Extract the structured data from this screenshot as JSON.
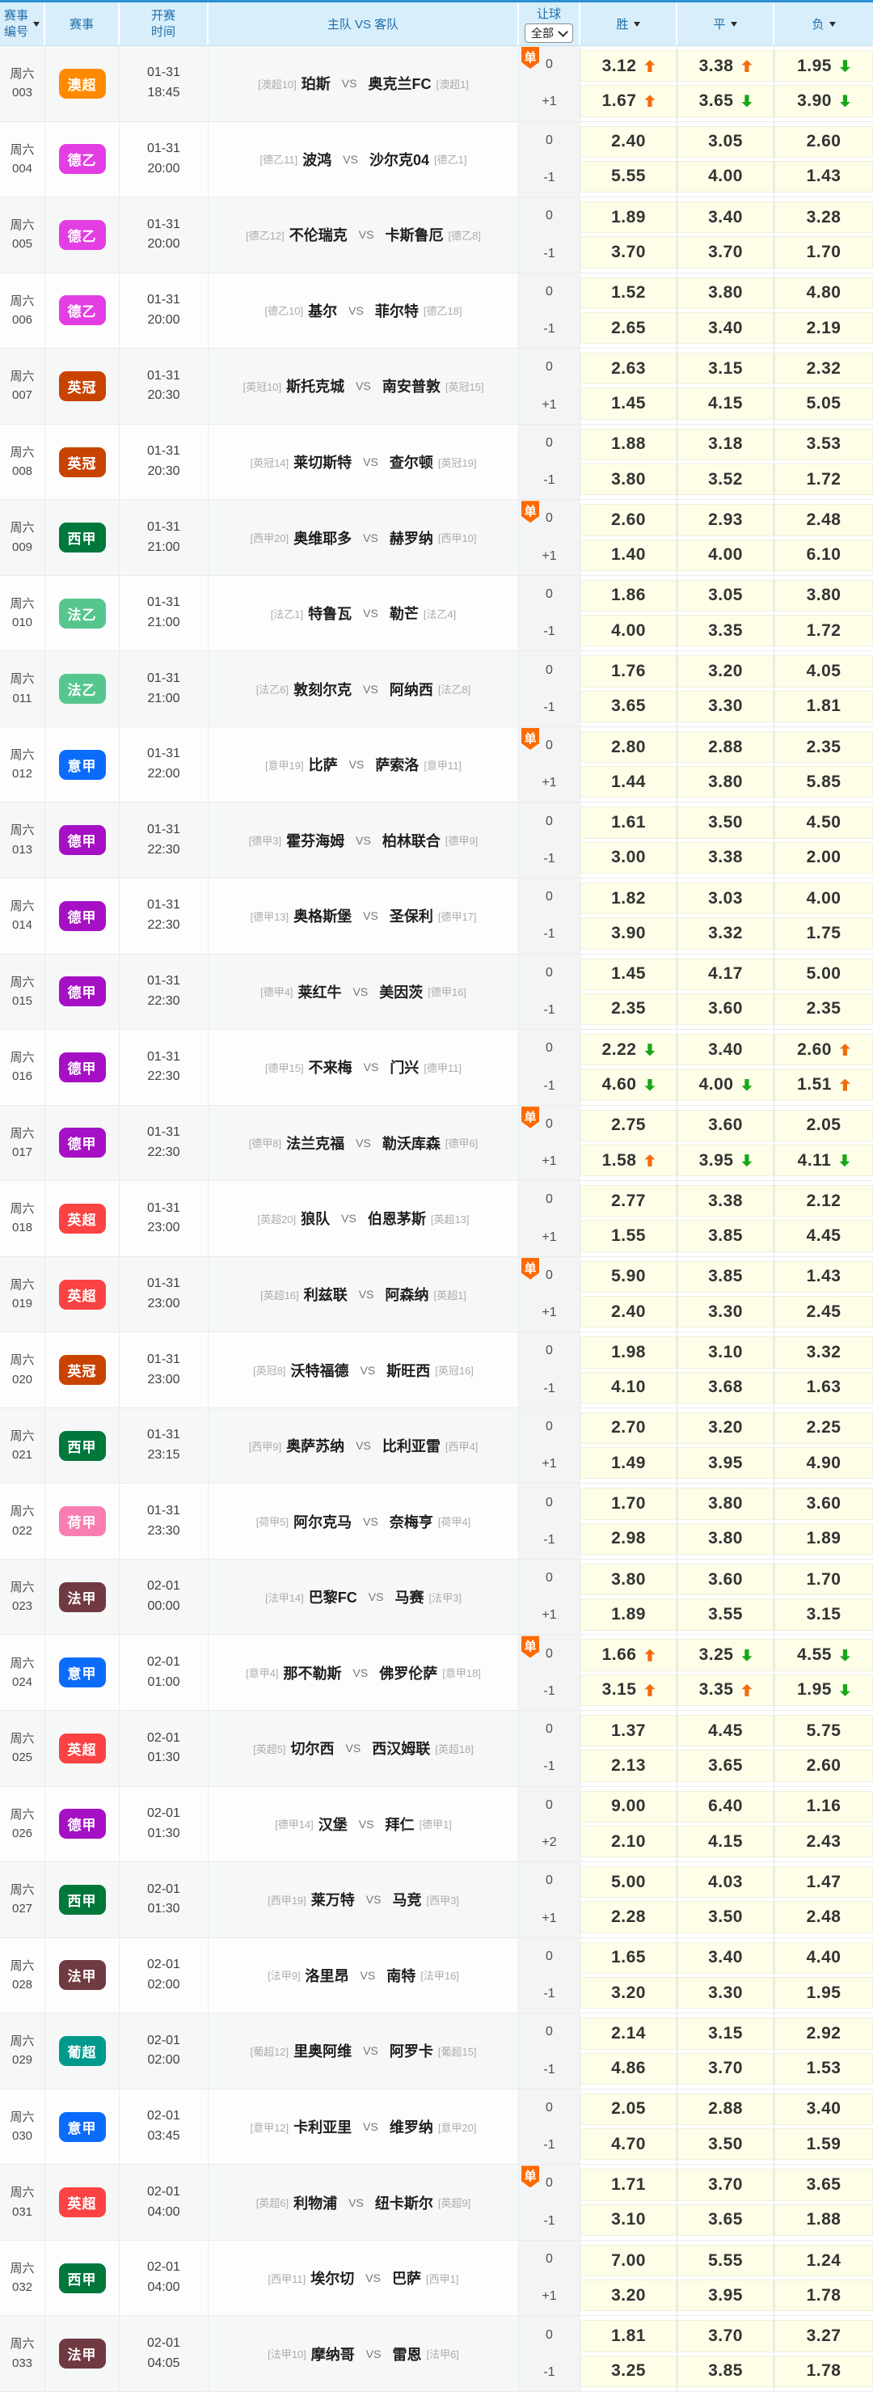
{
  "header": {
    "match_no_line1": "赛事",
    "match_no_line2": "编号",
    "league": "赛事",
    "time_line1": "开赛",
    "time_line2": "时间",
    "teams": "主队 VS 客队",
    "handicap": "让球",
    "filter_all": "全部",
    "win": "胜",
    "draw": "平",
    "lose": "负"
  },
  "dan_label": "单",
  "vs_label": "VS",
  "colors": {
    "top_border": "#2B8FD0",
    "header_bg": "#D8EEFB",
    "header_text": "#1E6DA8",
    "odds_bg": "#FDFDE8",
    "odds_up": "#F26C0D",
    "odds_down": "#16A816",
    "dan_badge": "#FF6A00",
    "league": {
      "澳超": "#FF8A00",
      "德乙": "#E33EE3",
      "英冠": "#C84300",
      "西甲": "#00783C",
      "法乙": "#56C68E",
      "意甲": "#0B6CFB",
      "德甲": "#A610C5",
      "英超": "#FB4343",
      "荷甲": "#F87EB2",
      "法甲": "#703A42",
      "葡超": "#009A8C"
    }
  },
  "matches": [
    {
      "day": "周六",
      "no": "003",
      "league": "澳超",
      "date": "01-31",
      "time": "18:45",
      "dan": true,
      "home_rank": "[澳超10]",
      "home": "珀斯",
      "away": "奥克兰FC",
      "away_rank": "[澳超1]",
      "lines": [
        [
          "0",
          "3.12",
          "up",
          "3.38",
          "up",
          "1.95",
          "down"
        ],
        [
          "+1",
          "1.67",
          "up",
          "3.65",
          "down",
          "3.90",
          "down"
        ]
      ]
    },
    {
      "day": "周六",
      "no": "004",
      "league": "德乙",
      "date": "01-31",
      "time": "20:00",
      "dan": false,
      "home_rank": "[德乙11]",
      "home": "波鸿",
      "away": "沙尔克04",
      "away_rank": "[德乙1]",
      "lines": [
        [
          "0",
          "2.40",
          "",
          "3.05",
          "",
          "2.60",
          ""
        ],
        [
          "-1",
          "5.55",
          "",
          "4.00",
          "",
          "1.43",
          ""
        ]
      ]
    },
    {
      "day": "周六",
      "no": "005",
      "league": "德乙",
      "date": "01-31",
      "time": "20:00",
      "dan": false,
      "home_rank": "[德乙12]",
      "home": "不伦瑞克",
      "away": "卡斯鲁厄",
      "away_rank": "[德乙8]",
      "lines": [
        [
          "0",
          "1.89",
          "",
          "3.40",
          "",
          "3.28",
          ""
        ],
        [
          "-1",
          "3.70",
          "",
          "3.70",
          "",
          "1.70",
          ""
        ]
      ]
    },
    {
      "day": "周六",
      "no": "006",
      "league": "德乙",
      "date": "01-31",
      "time": "20:00",
      "dan": false,
      "home_rank": "[德乙10]",
      "home": "基尔",
      "away": "菲尔特",
      "away_rank": "[德乙18]",
      "lines": [
        [
          "0",
          "1.52",
          "",
          "3.80",
          "",
          "4.80",
          ""
        ],
        [
          "-1",
          "2.65",
          "",
          "3.40",
          "",
          "2.19",
          ""
        ]
      ]
    },
    {
      "day": "周六",
      "no": "007",
      "league": "英冠",
      "date": "01-31",
      "time": "20:30",
      "dan": false,
      "home_rank": "[英冠10]",
      "home": "斯托克城",
      "away": "南安普敦",
      "away_rank": "[英冠15]",
      "lines": [
        [
          "0",
          "2.63",
          "",
          "3.15",
          "",
          "2.32",
          ""
        ],
        [
          "+1",
          "1.45",
          "",
          "4.15",
          "",
          "5.05",
          ""
        ]
      ]
    },
    {
      "day": "周六",
      "no": "008",
      "league": "英冠",
      "date": "01-31",
      "time": "20:30",
      "dan": false,
      "home_rank": "[英冠14]",
      "home": "莱切斯特",
      "away": "查尔顿",
      "away_rank": "[英冠19]",
      "lines": [
        [
          "0",
          "1.88",
          "",
          "3.18",
          "",
          "3.53",
          ""
        ],
        [
          "-1",
          "3.80",
          "",
          "3.52",
          "",
          "1.72",
          ""
        ]
      ]
    },
    {
      "day": "周六",
      "no": "009",
      "league": "西甲",
      "date": "01-31",
      "time": "21:00",
      "dan": true,
      "home_rank": "[西甲20]",
      "home": "奥维耶多",
      "away": "赫罗纳",
      "away_rank": "[西甲10]",
      "lines": [
        [
          "0",
          "2.60",
          "",
          "2.93",
          "",
          "2.48",
          ""
        ],
        [
          "+1",
          "1.40",
          "",
          "4.00",
          "",
          "6.10",
          ""
        ]
      ]
    },
    {
      "day": "周六",
      "no": "010",
      "league": "法乙",
      "date": "01-31",
      "time": "21:00",
      "dan": false,
      "home_rank": "[法乙1]",
      "home": "特鲁瓦",
      "away": "勒芒",
      "away_rank": "[法乙4]",
      "lines": [
        [
          "0",
          "1.86",
          "",
          "3.05",
          "",
          "3.80",
          ""
        ],
        [
          "-1",
          "4.00",
          "",
          "3.35",
          "",
          "1.72",
          ""
        ]
      ]
    },
    {
      "day": "周六",
      "no": "011",
      "league": "法乙",
      "date": "01-31",
      "time": "21:00",
      "dan": false,
      "home_rank": "[法乙6]",
      "home": "敦刻尔克",
      "away": "阿纳西",
      "away_rank": "[法乙8]",
      "lines": [
        [
          "0",
          "1.76",
          "",
          "3.20",
          "",
          "4.05",
          ""
        ],
        [
          "-1",
          "3.65",
          "",
          "3.30",
          "",
          "1.81",
          ""
        ]
      ]
    },
    {
      "day": "周六",
      "no": "012",
      "league": "意甲",
      "date": "01-31",
      "time": "22:00",
      "dan": true,
      "home_rank": "[意甲19]",
      "home": "比萨",
      "away": "萨索洛",
      "away_rank": "[意甲11]",
      "lines": [
        [
          "0",
          "2.80",
          "",
          "2.88",
          "",
          "2.35",
          ""
        ],
        [
          "+1",
          "1.44",
          "",
          "3.80",
          "",
          "5.85",
          ""
        ]
      ]
    },
    {
      "day": "周六",
      "no": "013",
      "league": "德甲",
      "date": "01-31",
      "time": "22:30",
      "dan": false,
      "home_rank": "[德甲3]",
      "home": "霍芬海姆",
      "away": "柏林联合",
      "away_rank": "[德甲9]",
      "lines": [
        [
          "0",
          "1.61",
          "",
          "3.50",
          "",
          "4.50",
          ""
        ],
        [
          "-1",
          "3.00",
          "",
          "3.38",
          "",
          "2.00",
          ""
        ]
      ]
    },
    {
      "day": "周六",
      "no": "014",
      "league": "德甲",
      "date": "01-31",
      "time": "22:30",
      "dan": false,
      "home_rank": "[德甲13]",
      "home": "奥格斯堡",
      "away": "圣保利",
      "away_rank": "[德甲17]",
      "lines": [
        [
          "0",
          "1.82",
          "",
          "3.03",
          "",
          "4.00",
          ""
        ],
        [
          "-1",
          "3.90",
          "",
          "3.32",
          "",
          "1.75",
          ""
        ]
      ]
    },
    {
      "day": "周六",
      "no": "015",
      "league": "德甲",
      "date": "01-31",
      "time": "22:30",
      "dan": false,
      "home_rank": "[德甲4]",
      "home": "莱红牛",
      "away": "美因茨",
      "away_rank": "[德甲16]",
      "lines": [
        [
          "0",
          "1.45",
          "",
          "4.17",
          "",
          "5.00",
          ""
        ],
        [
          "-1",
          "2.35",
          "",
          "3.60",
          "",
          "2.35",
          ""
        ]
      ]
    },
    {
      "day": "周六",
      "no": "016",
      "league": "德甲",
      "date": "01-31",
      "time": "22:30",
      "dan": false,
      "home_rank": "[德甲15]",
      "home": "不来梅",
      "away": "门兴",
      "away_rank": "[德甲11]",
      "lines": [
        [
          "0",
          "2.22",
          "down",
          "3.40",
          "",
          "2.60",
          "up"
        ],
        [
          "-1",
          "4.60",
          "down",
          "4.00",
          "down",
          "1.51",
          "up"
        ]
      ]
    },
    {
      "day": "周六",
      "no": "017",
      "league": "德甲",
      "date": "01-31",
      "time": "22:30",
      "dan": true,
      "home_rank": "[德甲8]",
      "home": "法兰克福",
      "away": "勒沃库森",
      "away_rank": "[德甲6]",
      "lines": [
        [
          "0",
          "2.75",
          "",
          "3.60",
          "",
          "2.05",
          ""
        ],
        [
          "+1",
          "1.58",
          "up",
          "3.95",
          "down",
          "4.11",
          "down"
        ]
      ]
    },
    {
      "day": "周六",
      "no": "018",
      "league": "英超",
      "date": "01-31",
      "time": "23:00",
      "dan": false,
      "home_rank": "[英超20]",
      "home": "狼队",
      "away": "伯恩茅斯",
      "away_rank": "[英超13]",
      "lines": [
        [
          "0",
          "2.77",
          "",
          "3.38",
          "",
          "2.12",
          ""
        ],
        [
          "+1",
          "1.55",
          "",
          "3.85",
          "",
          "4.45",
          ""
        ]
      ]
    },
    {
      "day": "周六",
      "no": "019",
      "league": "英超",
      "date": "01-31",
      "time": "23:00",
      "dan": true,
      "home_rank": "[英超16]",
      "home": "利兹联",
      "away": "阿森纳",
      "away_rank": "[英超1]",
      "lines": [
        [
          "0",
          "5.90",
          "",
          "3.85",
          "",
          "1.43",
          ""
        ],
        [
          "+1",
          "2.40",
          "",
          "3.30",
          "",
          "2.45",
          ""
        ]
      ]
    },
    {
      "day": "周六",
      "no": "020",
      "league": "英冠",
      "date": "01-31",
      "time": "23:00",
      "dan": false,
      "home_rank": "[英冠8]",
      "home": "沃特福德",
      "away": "斯旺西",
      "away_rank": "[英冠16]",
      "lines": [
        [
          "0",
          "1.98",
          "",
          "3.10",
          "",
          "3.32",
          ""
        ],
        [
          "-1",
          "4.10",
          "",
          "3.68",
          "",
          "1.63",
          ""
        ]
      ]
    },
    {
      "day": "周六",
      "no": "021",
      "league": "西甲",
      "date": "01-31",
      "time": "23:15",
      "dan": false,
      "home_rank": "[西甲9]",
      "home": "奥萨苏纳",
      "away": "比利亚雷",
      "away_rank": "[西甲4]",
      "lines": [
        [
          "0",
          "2.70",
          "",
          "3.20",
          "",
          "2.25",
          ""
        ],
        [
          "+1",
          "1.49",
          "",
          "3.95",
          "",
          "4.90",
          ""
        ]
      ]
    },
    {
      "day": "周六",
      "no": "022",
      "league": "荷甲",
      "date": "01-31",
      "time": "23:30",
      "dan": false,
      "home_rank": "[荷甲5]",
      "home": "阿尔克马",
      "away": "奈梅亨",
      "away_rank": "[荷甲4]",
      "lines": [
        [
          "0",
          "1.70",
          "",
          "3.80",
          "",
          "3.60",
          ""
        ],
        [
          "-1",
          "2.98",
          "",
          "3.80",
          "",
          "1.89",
          ""
        ]
      ]
    },
    {
      "day": "周六",
      "no": "023",
      "league": "法甲",
      "date": "02-01",
      "time": "00:00",
      "dan": false,
      "home_rank": "[法甲14]",
      "home": "巴黎FC",
      "away": "马赛",
      "away_rank": "[法甲3]",
      "lines": [
        [
          "0",
          "3.80",
          "",
          "3.60",
          "",
          "1.70",
          ""
        ],
        [
          "+1",
          "1.89",
          "",
          "3.55",
          "",
          "3.15",
          ""
        ]
      ]
    },
    {
      "day": "周六",
      "no": "024",
      "league": "意甲",
      "date": "02-01",
      "time": "01:00",
      "dan": true,
      "home_rank": "[意甲4]",
      "home": "那不勒斯",
      "away": "佛罗伦萨",
      "away_rank": "[意甲18]",
      "lines": [
        [
          "0",
          "1.66",
          "up",
          "3.25",
          "down",
          "4.55",
          "down"
        ],
        [
          "-1",
          "3.15",
          "up",
          "3.35",
          "up",
          "1.95",
          "down"
        ]
      ]
    },
    {
      "day": "周六",
      "no": "025",
      "league": "英超",
      "date": "02-01",
      "time": "01:30",
      "dan": false,
      "home_rank": "[英超5]",
      "home": "切尔西",
      "away": "西汉姆联",
      "away_rank": "[英超18]",
      "lines": [
        [
          "0",
          "1.37",
          "",
          "4.45",
          "",
          "5.75",
          ""
        ],
        [
          "-1",
          "2.13",
          "",
          "3.65",
          "",
          "2.60",
          ""
        ]
      ]
    },
    {
      "day": "周六",
      "no": "026",
      "league": "德甲",
      "date": "02-01",
      "time": "01:30",
      "dan": false,
      "home_rank": "[德甲14]",
      "home": "汉堡",
      "away": "拜仁",
      "away_rank": "[德甲1]",
      "lines": [
        [
          "0",
          "9.00",
          "",
          "6.40",
          "",
          "1.16",
          ""
        ],
        [
          "+2",
          "2.10",
          "",
          "4.15",
          "",
          "2.43",
          ""
        ]
      ]
    },
    {
      "day": "周六",
      "no": "027",
      "league": "西甲",
      "date": "02-01",
      "time": "01:30",
      "dan": false,
      "home_rank": "[西甲19]",
      "home": "莱万特",
      "away": "马竞",
      "away_rank": "[西甲3]",
      "lines": [
        [
          "0",
          "5.00",
          "",
          "4.03",
          "",
          "1.47",
          ""
        ],
        [
          "+1",
          "2.28",
          "",
          "3.50",
          "",
          "2.48",
          ""
        ]
      ]
    },
    {
      "day": "周六",
      "no": "028",
      "league": "法甲",
      "date": "02-01",
      "time": "02:00",
      "dan": false,
      "home_rank": "[法甲9]",
      "home": "洛里昂",
      "away": "南特",
      "away_rank": "[法甲16]",
      "lines": [
        [
          "0",
          "1.65",
          "",
          "3.40",
          "",
          "4.40",
          ""
        ],
        [
          "-1",
          "3.20",
          "",
          "3.30",
          "",
          "1.95",
          ""
        ]
      ]
    },
    {
      "day": "周六",
      "no": "029",
      "league": "葡超",
      "date": "02-01",
      "time": "02:00",
      "dan": false,
      "home_rank": "[葡超12]",
      "home": "里奥阿维",
      "away": "阿罗卡",
      "away_rank": "[葡超15]",
      "lines": [
        [
          "0",
          "2.14",
          "",
          "3.15",
          "",
          "2.92",
          ""
        ],
        [
          "-1",
          "4.86",
          "",
          "3.70",
          "",
          "1.53",
          ""
        ]
      ]
    },
    {
      "day": "周六",
      "no": "030",
      "league": "意甲",
      "date": "02-01",
      "time": "03:45",
      "dan": false,
      "home_rank": "[意甲12]",
      "home": "卡利亚里",
      "away": "维罗纳",
      "away_rank": "[意甲20]",
      "lines": [
        [
          "0",
          "2.05",
          "",
          "2.88",
          "",
          "3.40",
          ""
        ],
        [
          "-1",
          "4.70",
          "",
          "3.50",
          "",
          "1.59",
          ""
        ]
      ]
    },
    {
      "day": "周六",
      "no": "031",
      "league": "英超",
      "date": "02-01",
      "time": "04:00",
      "dan": true,
      "home_rank": "[英超6]",
      "home": "利物浦",
      "away": "纽卡斯尔",
      "away_rank": "[英超9]",
      "lines": [
        [
          "0",
          "1.71",
          "",
          "3.70",
          "",
          "3.65",
          ""
        ],
        [
          "-1",
          "3.10",
          "",
          "3.65",
          "",
          "1.88",
          ""
        ]
      ]
    },
    {
      "day": "周六",
      "no": "032",
      "league": "西甲",
      "date": "02-01",
      "time": "04:00",
      "dan": false,
      "home_rank": "[西甲11]",
      "home": "埃尔切",
      "away": "巴萨",
      "away_rank": "[西甲1]",
      "lines": [
        [
          "0",
          "7.00",
          "",
          "5.55",
          "",
          "1.24",
          ""
        ],
        [
          "+1",
          "3.20",
          "",
          "3.95",
          "",
          "1.78",
          ""
        ]
      ]
    },
    {
      "day": "周六",
      "no": "033",
      "league": "法甲",
      "date": "02-01",
      "time": "04:05",
      "dan": false,
      "home_rank": "[法甲10]",
      "home": "摩纳哥",
      "away": "雷恩",
      "away_rank": "[法甲6]",
      "lines": [
        [
          "0",
          "1.81",
          "",
          "3.70",
          "",
          "3.27",
          ""
        ],
        [
          "-1",
          "3.25",
          "",
          "3.85",
          "",
          "1.78",
          ""
        ]
      ]
    }
  ]
}
